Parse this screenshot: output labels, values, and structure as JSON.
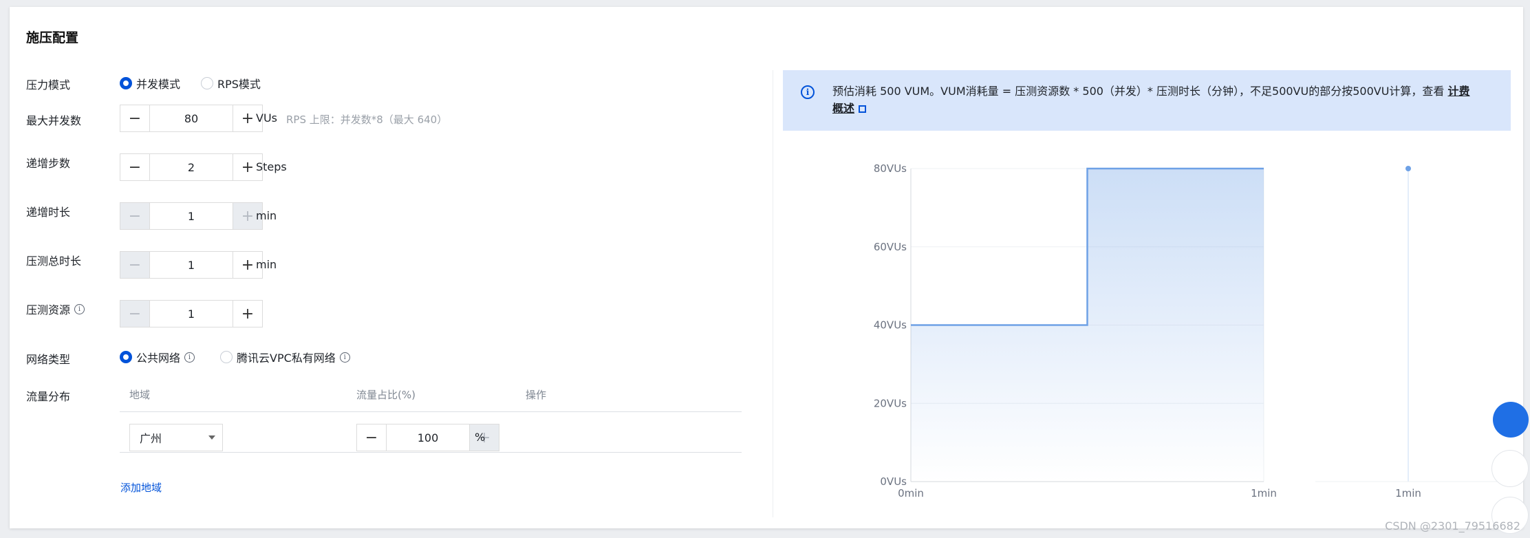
{
  "section_title": "施压配置",
  "pressure_mode": {
    "label": "压力模式",
    "options": [
      {
        "label": "并发模式",
        "selected": true
      },
      {
        "label": "RPS模式",
        "selected": false
      }
    ]
  },
  "max_concurrency": {
    "label": "最大并发数",
    "value": "80",
    "unit": "VUs",
    "hint": "RPS 上限：并发数*8（最大 640）"
  },
  "ramp_steps": {
    "label": "递增步数",
    "value": "2",
    "unit": "Steps"
  },
  "ramp_duration": {
    "label": "递增时长",
    "value": "1",
    "unit": "min"
  },
  "total_duration": {
    "label": "压测总时长",
    "value": "1",
    "unit": "min"
  },
  "resources": {
    "label": "压测资源",
    "value": "1"
  },
  "network_type": {
    "label": "网络类型",
    "options": [
      {
        "label": "公共网络",
        "selected": true
      },
      {
        "label": "腾讯云VPC私有网络",
        "selected": false
      }
    ]
  },
  "traffic": {
    "label": "流量分布",
    "columns": [
      "地域",
      "流量占比(%)",
      "操作"
    ],
    "rows": [
      {
        "region": "广州",
        "ratio": "100",
        "unit": "%"
      }
    ],
    "add_link": "添加地域"
  },
  "banner": {
    "text": "预估消耗 500 VUM。VUM消耗量 = 压测资源数 * 500（并发）* 压测时长（分钟），不足500VU的部分按500VU计算，查看",
    "link": "计费概述"
  },
  "chart_data": {
    "type": "area",
    "y_ticks": [
      "0VUs",
      "20VUs",
      "40VUs",
      "60VUs",
      "80VUs"
    ],
    "ylim": [
      0,
      80
    ],
    "x_ticks": [
      "0min",
      "1min"
    ],
    "series": [
      {
        "x": [
          0,
          0.5,
          0.5,
          1.0
        ],
        "y": [
          40,
          40,
          80,
          80
        ]
      }
    ],
    "minimap": {
      "x_tick": "1min",
      "y": 80
    }
  },
  "watermark": "CSDN @2301_79516682",
  "colors": {
    "primary": "#0052d9",
    "banner_bg": "#d9e6fb",
    "line": "#6ea1e6"
  }
}
